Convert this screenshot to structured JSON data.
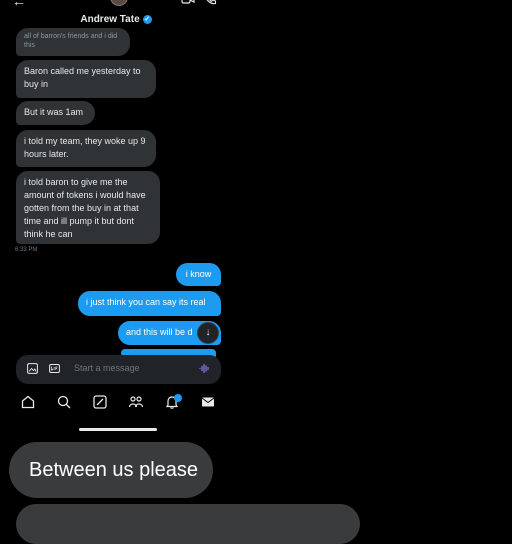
{
  "header": {
    "contact_name": "Andrew Tate"
  },
  "messages": [
    {
      "side": "in",
      "text": "all of barron's friends and i did this"
    },
    {
      "side": "in",
      "text": "Baron called me yesterday to buy in"
    },
    {
      "side": "in",
      "text": "But it was 1am"
    },
    {
      "side": "in",
      "text": "i told my team, they woke up 9 hours later."
    },
    {
      "side": "in",
      "text": "i told baron to give me the amount of tokens i would have gotten from the buy in at that time and ill pump it but dont think he can"
    },
    {
      "side": "out",
      "text": "i know"
    },
    {
      "side": "out",
      "text": "i just think you can say its real"
    },
    {
      "side": "out",
      "text": "and this will be d"
    }
  ],
  "timestamp": "6:33 PM",
  "composer": {
    "placeholder": "Start a message"
  },
  "colors": {
    "accent": "#1d9bf0",
    "incoming_bubble": "#2f3336",
    "background": "#000000"
  },
  "overlay_messages": [
    "Between us please"
  ]
}
